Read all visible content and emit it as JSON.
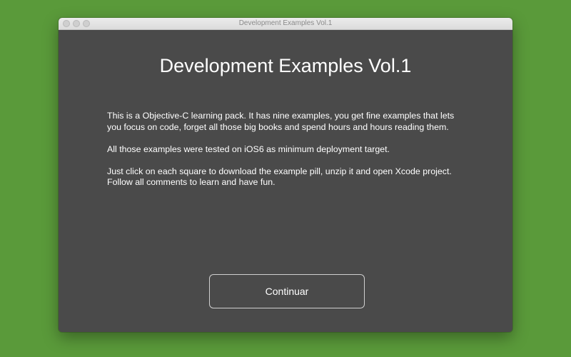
{
  "window": {
    "title": "Development Examples Vol.1"
  },
  "main": {
    "heading": "Development Examples Vol.1",
    "paragraphs": [
      "This is a Objective-C learning pack. It has nine examples, you get fine examples that lets you focus on code, forget all those big books and spend hours and hours reading them.",
      "All those examples were tested on iOS6 as minimum deployment target.",
      "Just click on each square to download the example pill, unzip it and open Xcode project. Follow all comments to learn and have fun."
    ],
    "continue_label": "Continuar"
  },
  "colors": {
    "desktop": "#5a9a3a",
    "window_bg": "#4a4a4a",
    "text": "#ffffff"
  }
}
